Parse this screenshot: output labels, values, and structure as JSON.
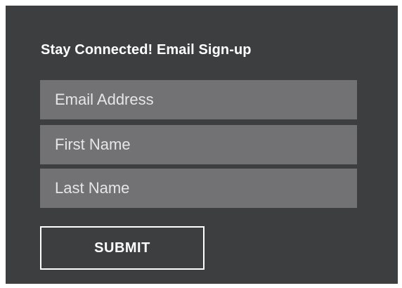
{
  "signup": {
    "title": "Stay Connected! Email Sign-up",
    "fields": [
      {
        "placeholder": "Email Address"
      },
      {
        "placeholder": "First Name"
      },
      {
        "placeholder": "Last Name"
      }
    ],
    "submit_label": "SUBMIT"
  },
  "colors": {
    "panel_background": "#3d3e40",
    "field_background": "#727274",
    "text": "#ffffff"
  }
}
